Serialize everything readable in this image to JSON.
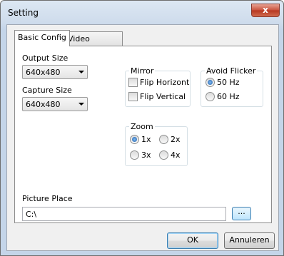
{
  "window": {
    "title": "Setting",
    "close_label": "x"
  },
  "tabs": [
    {
      "label": "Basic Config",
      "active": true
    },
    {
      "label": "Video Setting",
      "active": false
    }
  ],
  "basic": {
    "output_size": {
      "label": "Output Size",
      "value": "640x480"
    },
    "capture_size": {
      "label": "Capture Size",
      "value": "640x480"
    },
    "mirror": {
      "title": "Mirror",
      "flip_horizontal": {
        "label": "Flip Horizont",
        "checked": false
      },
      "flip_vertical": {
        "label": "Flip Vertical",
        "checked": false
      }
    },
    "avoid_flicker": {
      "title": "Avoid Flicker",
      "options": [
        {
          "label": "50 Hz",
          "selected": true
        },
        {
          "label": "60 Hz",
          "selected": false
        }
      ]
    },
    "zoom": {
      "title": "Zoom",
      "options": [
        {
          "label": "1x",
          "selected": true
        },
        {
          "label": "2x",
          "selected": false
        },
        {
          "label": "3x",
          "selected": false
        },
        {
          "label": "4x",
          "selected": false
        }
      ]
    },
    "picture_place": {
      "label": "Picture Place",
      "value": "C:\\",
      "browse_label": "..."
    }
  },
  "footer": {
    "ok_label": "OK",
    "cancel_label": "Annuleren"
  },
  "colors": {
    "accent": "#3c7fb1",
    "close": "#c9503a",
    "radio_dot": "#1f5fa8"
  }
}
